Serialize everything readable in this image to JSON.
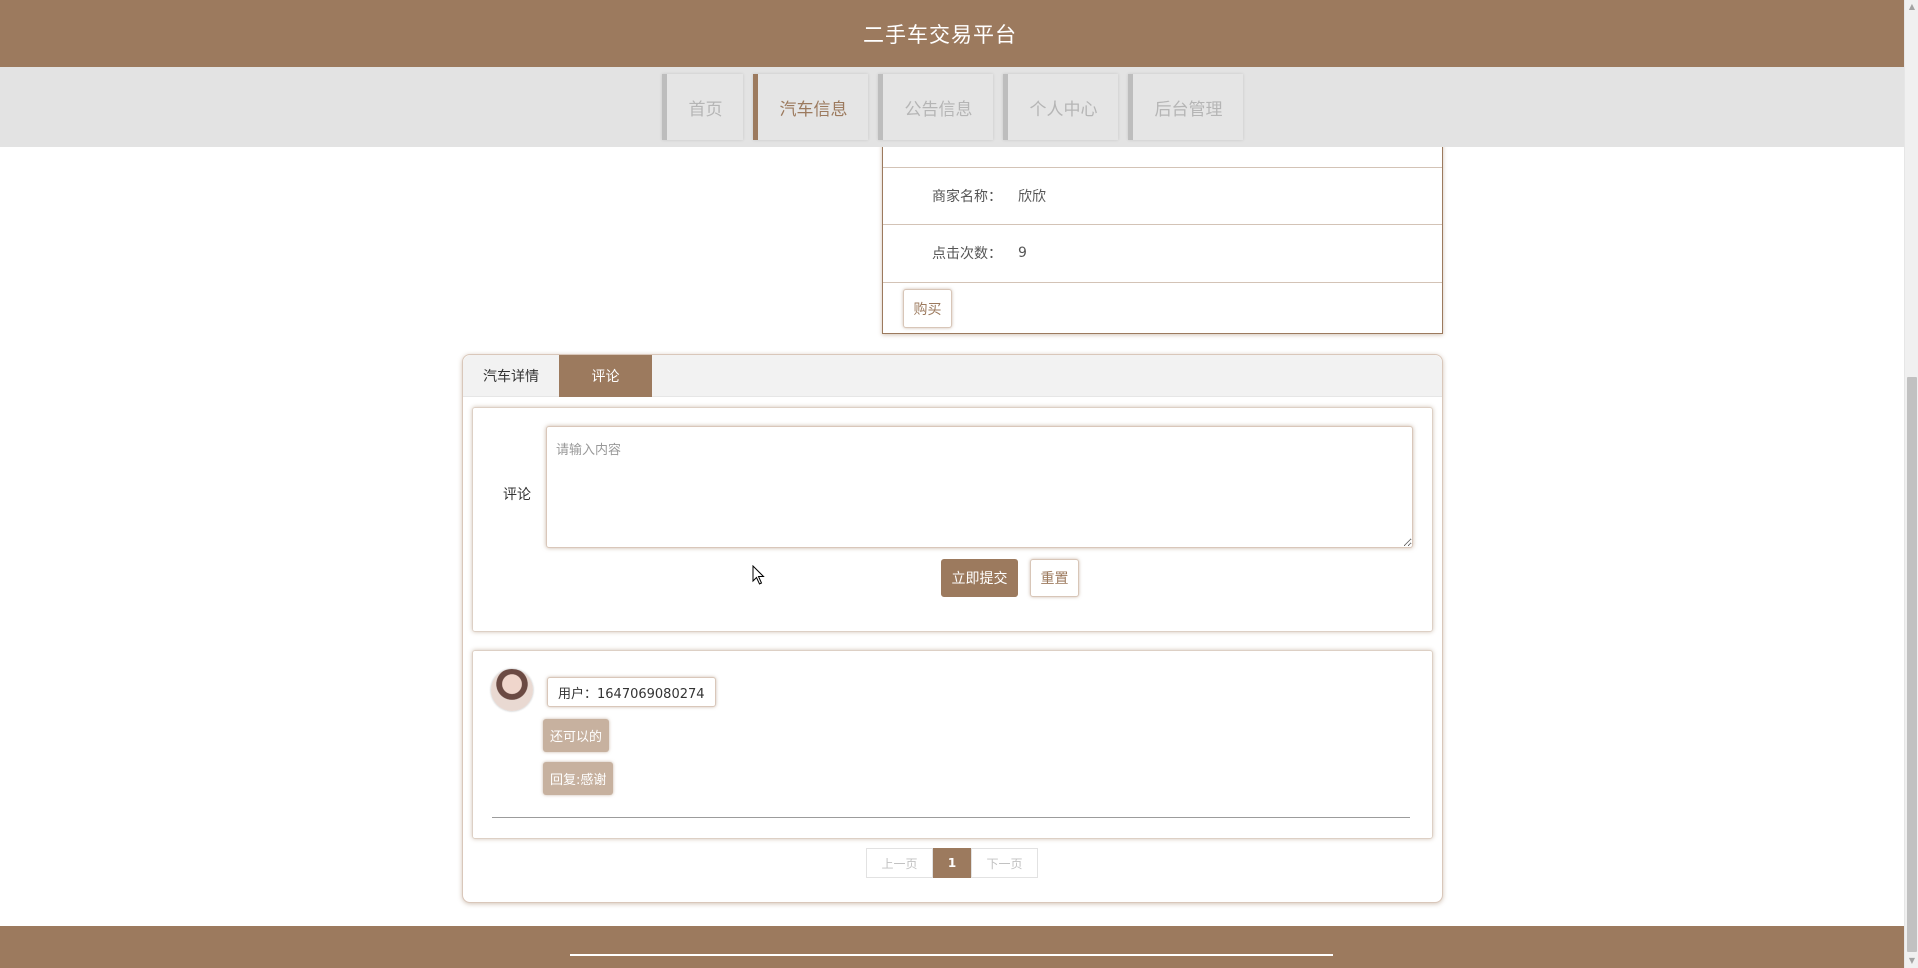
{
  "header": {
    "site_title": "二手车交易平台",
    "brand_color": "#9c7a5e"
  },
  "nav": {
    "items": [
      {
        "label": "首页",
        "active": false
      },
      {
        "label": "汽车信息",
        "active": true
      },
      {
        "label": "公告信息",
        "active": false
      },
      {
        "label": "个人中心",
        "active": false
      },
      {
        "label": "后台管理",
        "active": false
      }
    ]
  },
  "info": {
    "rows": [
      {
        "label": "商家名称：",
        "value": "欣欣"
      },
      {
        "label": "点击次数：",
        "value": "9"
      }
    ],
    "buy_label": "购买"
  },
  "tabs": [
    {
      "label": "汽车详情",
      "active": false
    },
    {
      "label": "评论",
      "active": true
    }
  ],
  "comment_form": {
    "label": "评论",
    "placeholder": "请输入内容",
    "value": "",
    "submit_label": "立即提交",
    "reset_label": "重置"
  },
  "comments": [
    {
      "user": "用户：1647069080274",
      "content": "还可以的",
      "reply": "回复:感谢"
    }
  ],
  "pagination": {
    "prev_label": "上一页",
    "current": "1",
    "next_label": "下一页"
  }
}
